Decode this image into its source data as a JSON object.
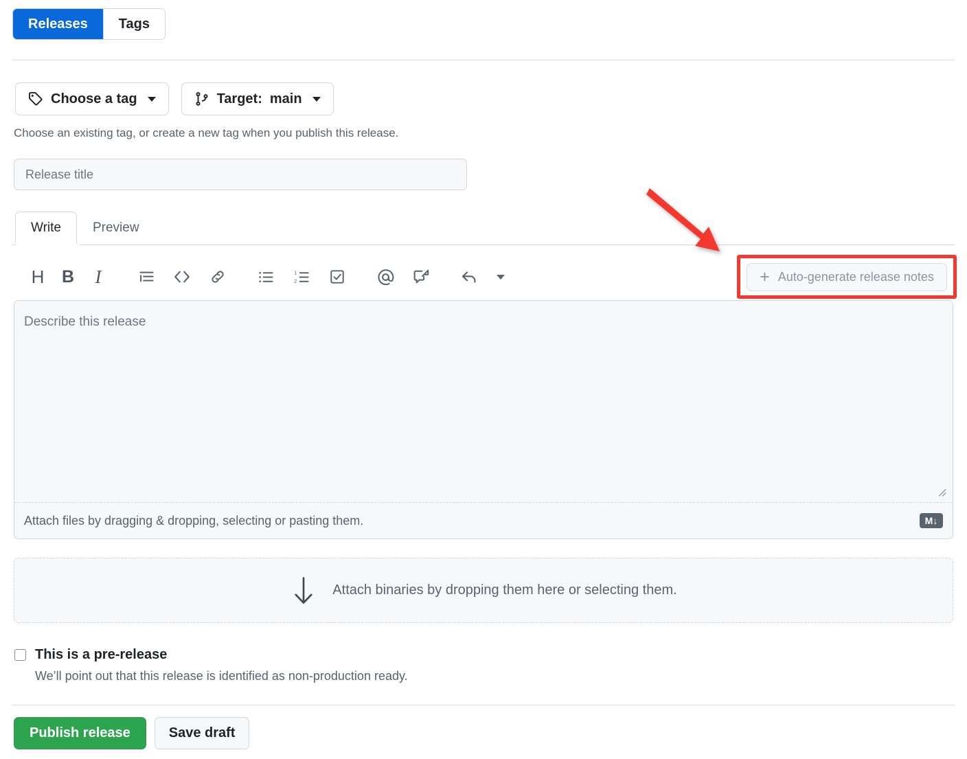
{
  "top_tabs": [
    {
      "label": "Releases",
      "active": true
    },
    {
      "label": "Tags",
      "active": false
    }
  ],
  "tag_selector": {
    "label": "Choose a tag",
    "icon": "tag-icon",
    "caret": "chevron-down-icon"
  },
  "target_selector": {
    "prefix": "Target:",
    "value": "main",
    "icon": "git-branch-icon",
    "caret": "chevron-down-icon"
  },
  "helper_text": "Choose an existing tag, or create a new tag when you publish this release.",
  "release_title": {
    "placeholder": "Release title",
    "value": ""
  },
  "editor": {
    "tabs": [
      {
        "label": "Write",
        "active": true
      },
      {
        "label": "Preview",
        "active": false
      }
    ],
    "toolbar": [
      {
        "name": "heading-icon",
        "glyph": "H"
      },
      {
        "name": "bold-icon",
        "glyph": "B"
      },
      {
        "name": "italic-icon",
        "glyph": "I"
      },
      {
        "name": "quote-icon",
        "glyph": ""
      },
      {
        "name": "code-icon",
        "glyph": "<>"
      },
      {
        "name": "link-icon",
        "glyph": ""
      },
      {
        "name": "unordered-list-icon",
        "glyph": ""
      },
      {
        "name": "ordered-list-icon",
        "glyph": ""
      },
      {
        "name": "task-list-icon",
        "glyph": ""
      },
      {
        "name": "mention-icon",
        "glyph": "@"
      },
      {
        "name": "reference-icon",
        "glyph": ""
      },
      {
        "name": "reply-icon",
        "glyph": ""
      }
    ],
    "autogenerate_button": {
      "label": "Auto-generate release notes",
      "plus": "+",
      "icon": "plus-icon",
      "disabled": true
    },
    "description": {
      "placeholder": "Describe this release",
      "value": ""
    },
    "attach_hint": "Attach files by dragging & dropping, selecting or pasting them.",
    "markdown_badge": "M↓"
  },
  "binaries_dropzone": {
    "text": "Attach binaries by dropping them here or selecting them.",
    "icon": "download-arrow-icon"
  },
  "prerelease": {
    "label": "This is a pre-release",
    "description": "We’ll point out that this release is identified as non-production ready.",
    "checked": false
  },
  "actions": {
    "publish_label": "Publish release",
    "draft_label": "Save draft"
  },
  "annotations": {
    "arrow": "red-arrow-pointing-to-autogenerate",
    "highlight_box": "red-highlight-box-autogenerate"
  },
  "colors": {
    "accent_blue": "#0969da",
    "green": "#2da44e",
    "annotation_red": "#f5392e",
    "muted_text": "#59636e",
    "border": "#d0d7de",
    "surface": "#f6f8fa"
  }
}
